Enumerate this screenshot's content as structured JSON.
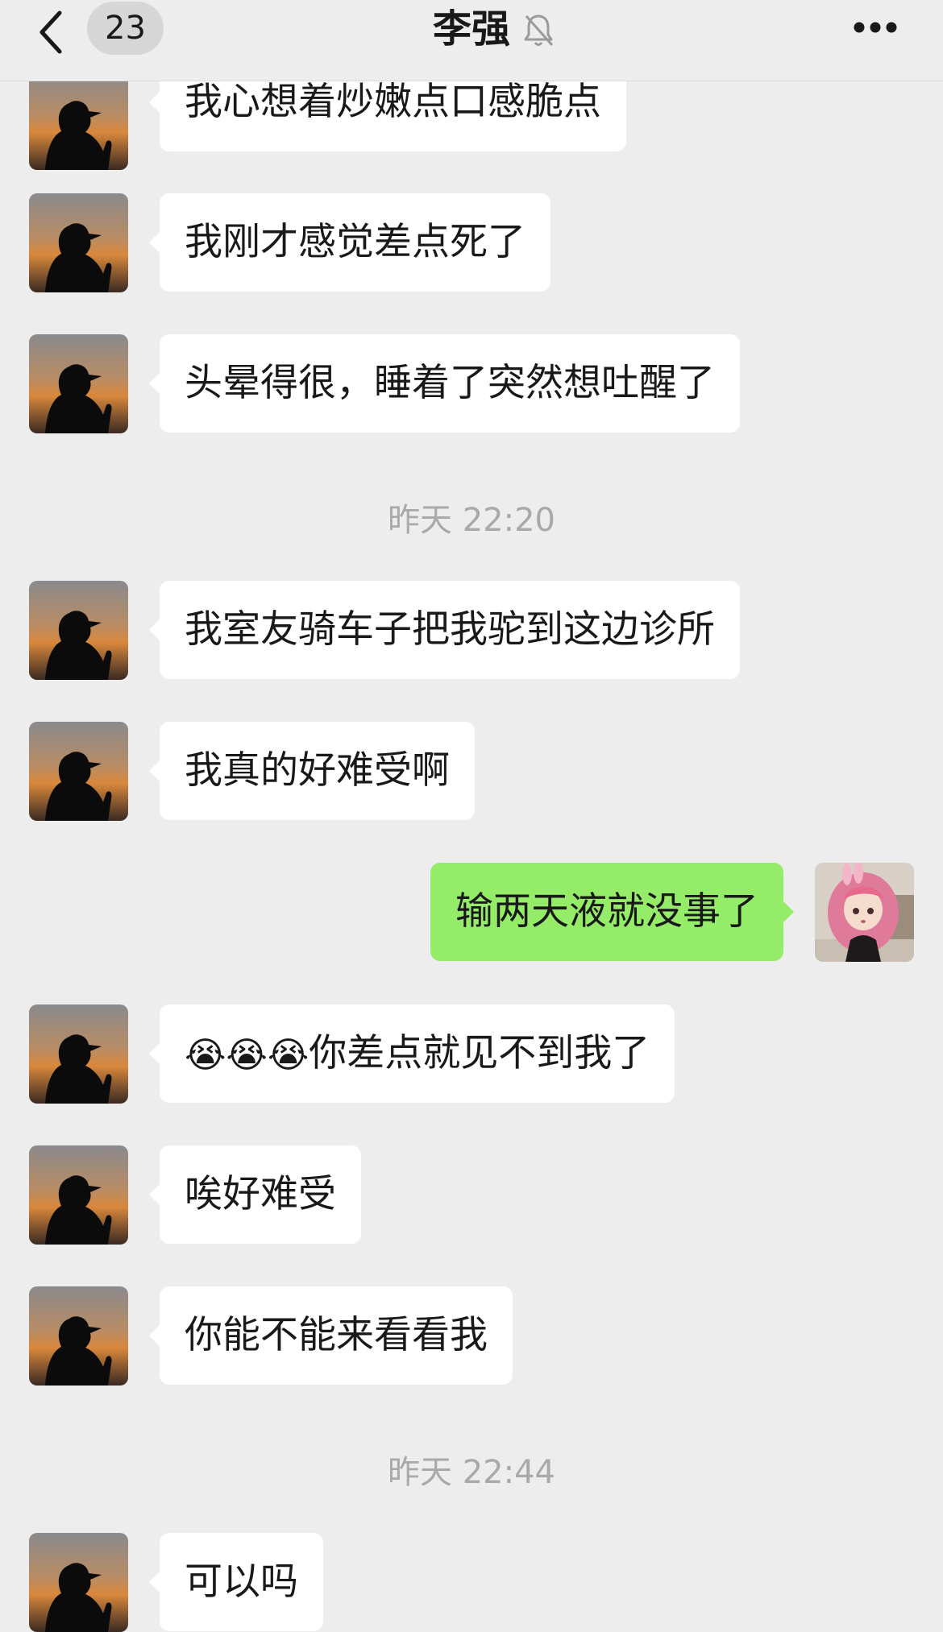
{
  "header": {
    "back_icon": "chevron-left-icon",
    "unread_count": "23",
    "title": "李强",
    "mute_icon": "bell-slash-icon",
    "more_icon": "ellipsis-icon"
  },
  "messages": [
    {
      "side": "in",
      "text": "我心想着炒嫩点口感脆点"
    },
    {
      "side": "in",
      "text": "我刚才感觉差点死了"
    },
    {
      "side": "in",
      "text": "头晕得很，睡着了突然想吐醒了"
    },
    {
      "timestamp": "昨天 22:20"
    },
    {
      "side": "in",
      "text": "我室友骑车子把我驼到这边诊所"
    },
    {
      "side": "in",
      "text": "我真的好难受啊"
    },
    {
      "side": "out",
      "text": "输两天液就没事了"
    },
    {
      "side": "in",
      "emoji": "😭😭😭",
      "text": "你差点就见不到我了"
    },
    {
      "side": "in",
      "text": "唉好难受"
    },
    {
      "side": "in",
      "text": "你能不能来看看我"
    },
    {
      "timestamp": "昨天 22:44"
    },
    {
      "side": "in",
      "text": "可以吗"
    }
  ],
  "colors": {
    "background": "#ededed",
    "incoming_bubble": "#ffffff",
    "outgoing_bubble": "#95ec69",
    "timestamp_text": "#a9a9a9"
  }
}
